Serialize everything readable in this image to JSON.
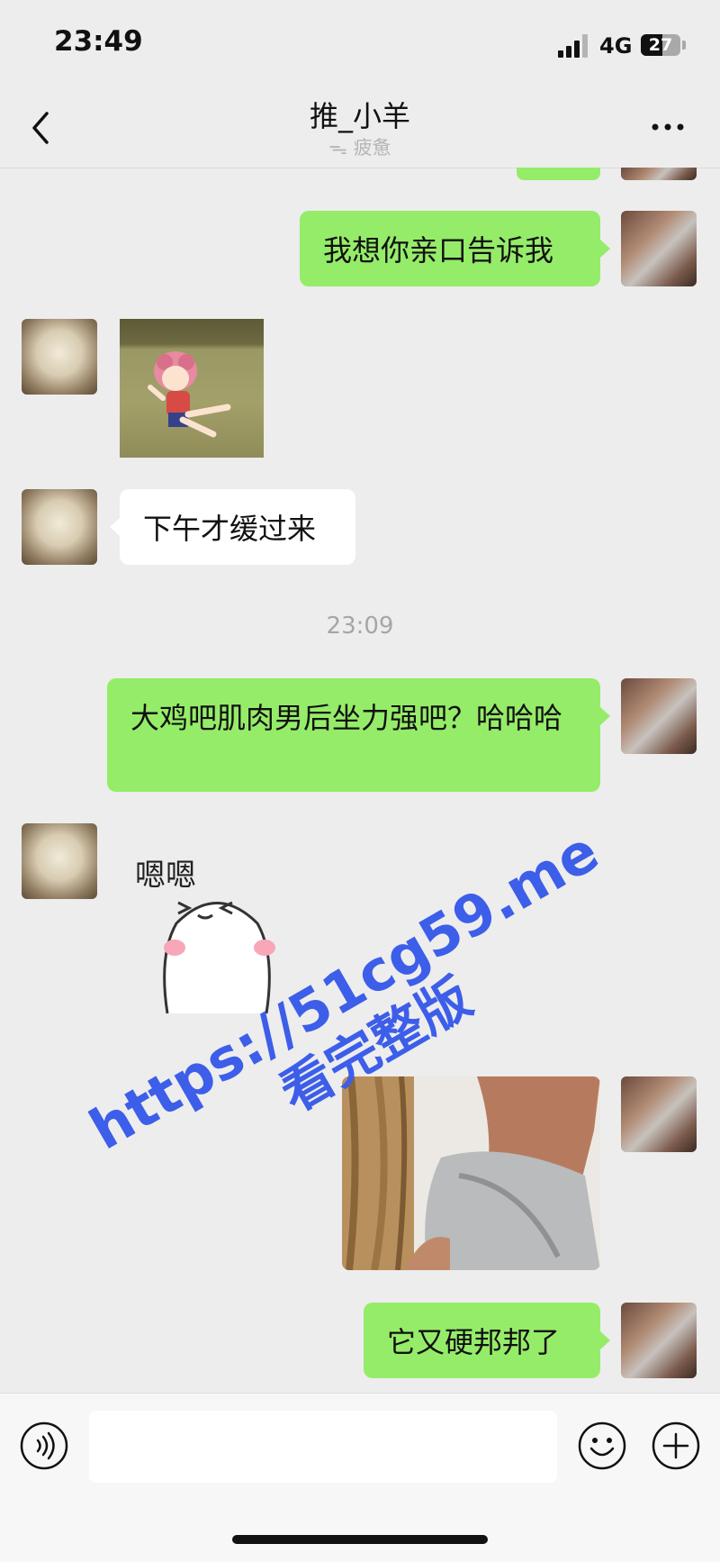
{
  "status_bar": {
    "time": "23:49",
    "network": "4G",
    "battery": "27"
  },
  "nav": {
    "title": "推_小羊",
    "status": "疲惫"
  },
  "messages": [
    {
      "text": "我想你亲口告诉我"
    },
    {
      "text": "下午才缓过来"
    },
    {
      "text": "大鸡吧肌肉男后坐力强吧？哈哈哈"
    },
    {
      "text": "它又硬邦邦了"
    }
  ],
  "timestamp": "23:09",
  "sticker_text": "嗯嗯",
  "watermark": {
    "line1": "https://51cg59.me",
    "line2": "看完整版"
  },
  "colors": {
    "bubble_self": "#95ec69",
    "bubble_peer": "#ffffff",
    "background": "#ededed",
    "watermark": "#3d5ee9"
  },
  "icons": [
    "back-icon",
    "more-icon",
    "voice-icon",
    "emoji-icon",
    "plus-icon"
  ]
}
